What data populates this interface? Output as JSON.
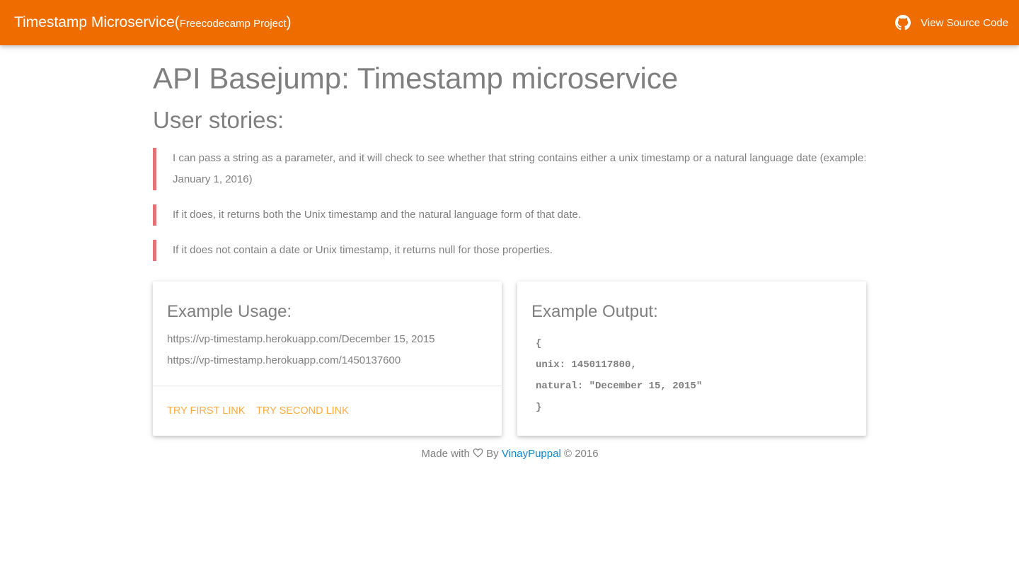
{
  "header": {
    "brand_main": "Timestamp Microservice",
    "brand_open": "(",
    "brand_sub": "Freecodecamp Project",
    "brand_close": ")",
    "source_link": "View Source Code",
    "source_icon": "github-icon",
    "bg_color": "#ef6c00"
  },
  "main": {
    "title": "API Basejump: Timestamp microservice",
    "subtitle": "User stories:",
    "stories": [
      "I can pass a string as a parameter, and it will check to see whether that string contains either a unix timestamp or a natural language date (example: January 1, 2016)",
      "If it does, it returns both the Unix timestamp and the natural language form of that date.",
      "If it does not contain a date or Unix timestamp, it returns null for those properties."
    ],
    "story_accent": "#e57373"
  },
  "usage_card": {
    "title": "Example Usage:",
    "lines": [
      "https://vp-timestamp.herokuapp.com/December 15, 2015",
      "https://vp-timestamp.herokuapp.com/1450137600"
    ],
    "actions": [
      "Try first link",
      "Try second link"
    ],
    "action_color": "#ffab40"
  },
  "output_card": {
    "title": "Example Output:",
    "code": [
      "{",
      "unix: 1450117800,",
      "natural: \"December 15, 2015\"",
      "}"
    ]
  },
  "footer": {
    "made_with": "Made with",
    "heart_icon": "heart-icon",
    "by": "By",
    "author": "VinayPuppal",
    "copyright": "© 2016",
    "link_color": "#0d87d6"
  }
}
